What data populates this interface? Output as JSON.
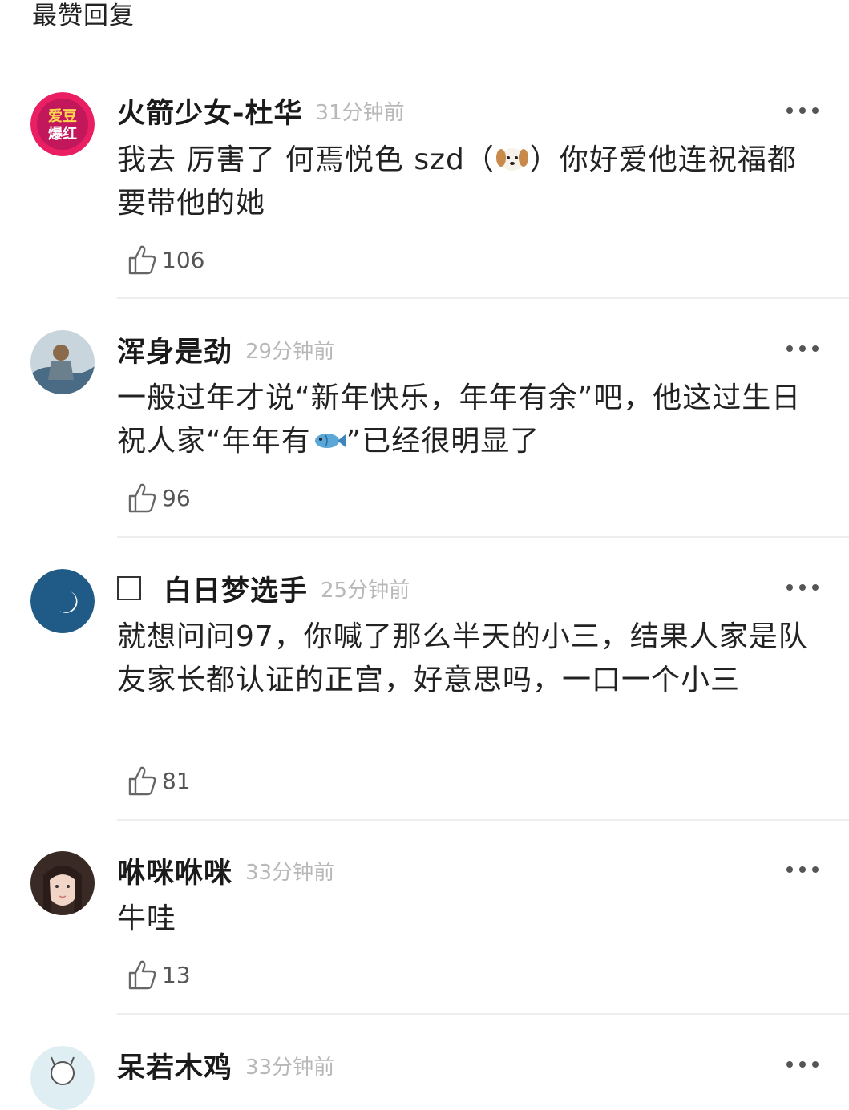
{
  "section_title": "最赞回复",
  "comments": [
    {
      "username": "火箭少女-杜华",
      "time": "31分钟前",
      "text_a": "我去 厉害了 何焉悦色 szd（",
      "emoji_name": "dog-face-emoji",
      "text_b": "）你好爱他连祝福都要带他的她",
      "likes": "106",
      "avatar_text_1": "爱豆",
      "avatar_text_2": "爆红",
      "avatar_colors": [
        "#c2185b",
        "#e91e63",
        "#ffd54f"
      ]
    },
    {
      "username": "浑身是劲",
      "time": "29分钟前",
      "text_a": "一般过年才说“新年快乐，年年有余”吧，他这过生日祝人家“年年有",
      "emoji_name": "fish-emoji",
      "text_b": "”已经很明显了",
      "likes": "96",
      "avatar_colors": [
        "#4a6b85",
        "#c9d5dd",
        "#8a6a4a"
      ]
    },
    {
      "username": "白日梦选手",
      "time": "25分钟前",
      "text_a": "就想问问97，你喊了那么半天的小三，结果人家是队友家长都认证的正宫，好意思吗，一口一个小三",
      "likes": "81",
      "avatar_colors": [
        "#1f5b86",
        "#ffffff"
      ]
    },
    {
      "username": "咻咪咻咪",
      "time": "33分钟前",
      "text_a": "牛哇",
      "likes": "13",
      "avatar_colors": [
        "#3a2a25",
        "#f1d6c8",
        "#e8c0b0"
      ]
    },
    {
      "username": "呆若木鸡",
      "time": "33分钟前",
      "avatar_colors": [
        "#dfeef2",
        "#555555"
      ]
    }
  ],
  "colors": {
    "username": "#1a1a1a",
    "timestamp": "#b8b8b8",
    "body_text": "#222222",
    "divider": "#eeeeee"
  }
}
